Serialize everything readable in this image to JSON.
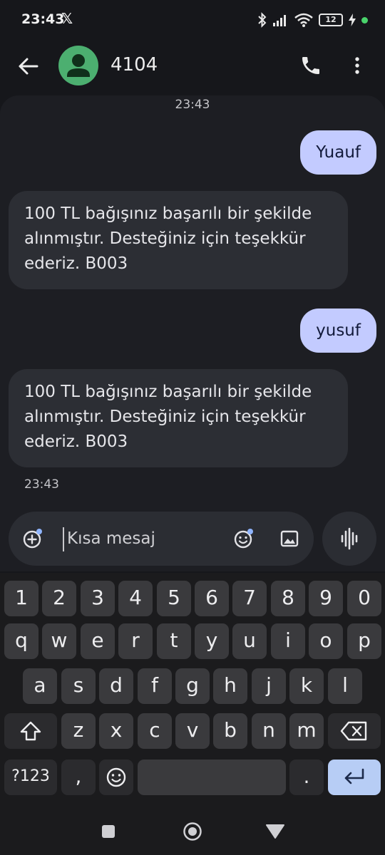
{
  "status_bar": {
    "time": "23:43",
    "social_icon": "x-logo-icon",
    "battery_level": "12",
    "icons": [
      "bluetooth-icon",
      "signal-icon",
      "wifi-icon",
      "battery-icon",
      "charging-icon"
    ]
  },
  "header": {
    "contact_name": "4104",
    "icons": [
      "back-arrow-icon",
      "contact-avatar-icon",
      "phone-icon",
      "more-vert-icon"
    ]
  },
  "conversation": {
    "timestamp_top": "23:43",
    "messages": [
      {
        "direction": "outgoing",
        "text": "Yuauf"
      },
      {
        "direction": "incoming",
        "text": "100 TL bağışınız başarılı bir şekilde alınmıştır. Desteğiniz için teşekkür ederiz. B003"
      },
      {
        "direction": "outgoing",
        "text": "yusuf"
      },
      {
        "direction": "incoming",
        "text": "100 TL bağışınız başarılı bir şekilde alınmıştır. Desteğiniz için teşekkür ederiz. B003"
      }
    ],
    "timestamp_bottom": "23:43"
  },
  "compose": {
    "placeholder": "Kısa mesaj",
    "value": "",
    "icons": [
      "add-attachment-icon",
      "emoji-icon",
      "gallery-icon",
      "voice-waveform-icon"
    ]
  },
  "keyboard": {
    "number_row": [
      "1",
      "2",
      "3",
      "4",
      "5",
      "6",
      "7",
      "8",
      "9",
      "0"
    ],
    "row1": [
      "q",
      "w",
      "e",
      "r",
      "t",
      "y",
      "u",
      "i",
      "o",
      "p"
    ],
    "row2": [
      "a",
      "s",
      "d",
      "f",
      "g",
      "h",
      "j",
      "k",
      "l"
    ],
    "row3": [
      "z",
      "x",
      "c",
      "v",
      "b",
      "n",
      "m"
    ],
    "symbols_key": "?123",
    "comma_key": ",",
    "period_key": ".",
    "icons": [
      "shift-icon",
      "backspace-icon",
      "emoji-key-icon",
      "enter-icon"
    ]
  },
  "nav_bar": {
    "icons": [
      "recents-square-icon",
      "home-circle-icon",
      "back-triangle-icon"
    ]
  },
  "colors": {
    "background": "#16171b",
    "conversation_bg": "#1d1e23",
    "outgoing_bubble": "#c3cbff",
    "incoming_bubble": "#2c2e34",
    "avatar": "#4caf70",
    "enter_key": "#b7cdf5"
  }
}
